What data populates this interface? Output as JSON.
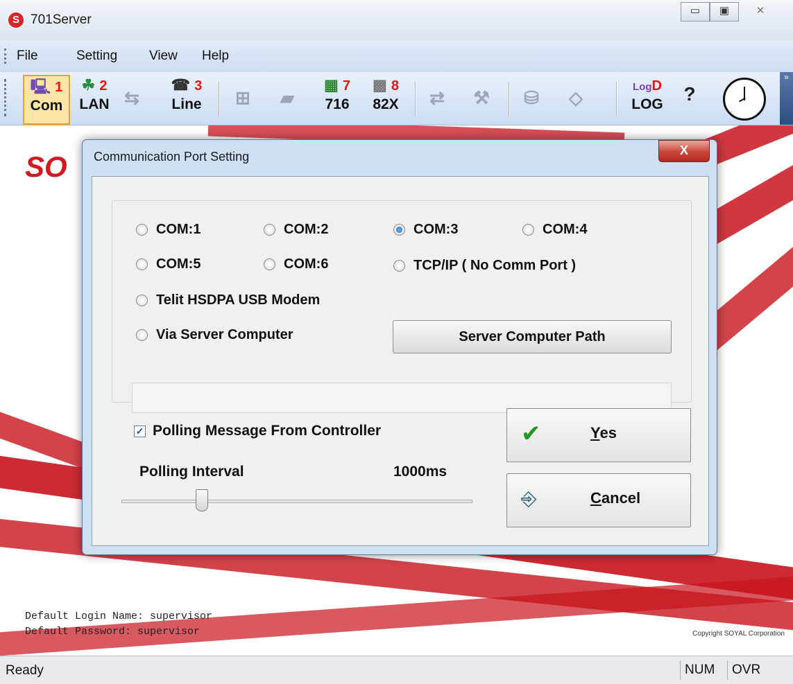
{
  "window": {
    "title": "701Server",
    "app_icon": "S",
    "controls": {
      "minimize": "▭",
      "restore": "▣",
      "close": "✕"
    }
  },
  "menu": [
    "File",
    "Setting",
    "View",
    "Help"
  ],
  "toolbar": {
    "buttons": [
      {
        "num": "1",
        "label": "Com",
        "icon": "computer-icon"
      },
      {
        "num": "2",
        "label": "LAN",
        "icon": "network-icon"
      },
      {
        "num": "",
        "label": "",
        "icon": "link-icon"
      },
      {
        "num": "3",
        "label": "Line",
        "icon": "line-icon"
      },
      {
        "num": "",
        "label": "",
        "icon": "server-icon"
      },
      {
        "num": "",
        "label": "",
        "icon": "card-icon"
      },
      {
        "num": "7",
        "label": "716",
        "icon": "board-716-icon"
      },
      {
        "num": "8",
        "label": "82X",
        "icon": "keypad-82x-icon"
      },
      {
        "num": "",
        "label": "",
        "icon": "transfer-icon"
      },
      {
        "num": "",
        "label": "",
        "icon": "tools-icon"
      },
      {
        "num": "",
        "label": "",
        "icon": "disk-icon"
      },
      {
        "num": "",
        "label": "",
        "icon": "diamond-icon"
      },
      {
        "num": "D",
        "label": "LOG",
        "icon": "log-icon",
        "icon_text": "Log"
      },
      {
        "num": "",
        "label": "",
        "icon": "help-icon"
      }
    ],
    "clock_icon": "clock-icon"
  },
  "background": {
    "logo_text": "SO",
    "login_info": [
      "Default Login Name: supervisor",
      "Default Password: supervisor"
    ],
    "copyright": "Copyright SOYAL Corporation"
  },
  "status": {
    "text": "Ready",
    "num": "NUM",
    "ovr": "OVR"
  },
  "dialog": {
    "title": "Communication Port Setting",
    "close": "X",
    "ports": [
      {
        "label": "COM:1",
        "selected": false
      },
      {
        "label": "COM:2",
        "selected": false
      },
      {
        "label": "COM:3",
        "selected": true
      },
      {
        "label": "COM:4",
        "selected": false
      },
      {
        "label": "COM:5",
        "selected": false
      },
      {
        "label": "COM:6",
        "selected": false
      },
      {
        "label": "TCP/IP ( No Comm Port )",
        "selected": false
      },
      {
        "label": "Telit HSDPA USB Modem",
        "selected": false
      },
      {
        "label": "Via Server Computer",
        "selected": false
      }
    ],
    "server_path_button": "Server Computer Path",
    "server_path_value": "",
    "polling_checkbox": "Polling Message From Controller",
    "polling_checked": true,
    "polling_interval_label": "Polling Interval",
    "polling_interval_value": "1000ms",
    "polling_interval_fraction": 0.22,
    "yes_first": "Y",
    "yes_rest": "es",
    "cancel_first": "C",
    "cancel_rest": "ancel"
  }
}
